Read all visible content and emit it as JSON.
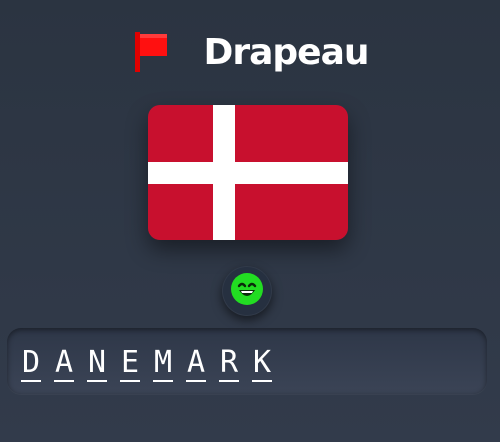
{
  "header": {
    "title": "Drapeau",
    "icon": "red-flag-icon"
  },
  "flag": {
    "country": "Danemark",
    "colors": {
      "field": "#c8102e",
      "cross": "#ffffff"
    }
  },
  "feedback": {
    "icon": "grinning-face-icon",
    "color": "#22dd22"
  },
  "answer": {
    "letters": [
      "D",
      "A",
      "N",
      "E",
      "M",
      "A",
      "R",
      "K"
    ]
  }
}
